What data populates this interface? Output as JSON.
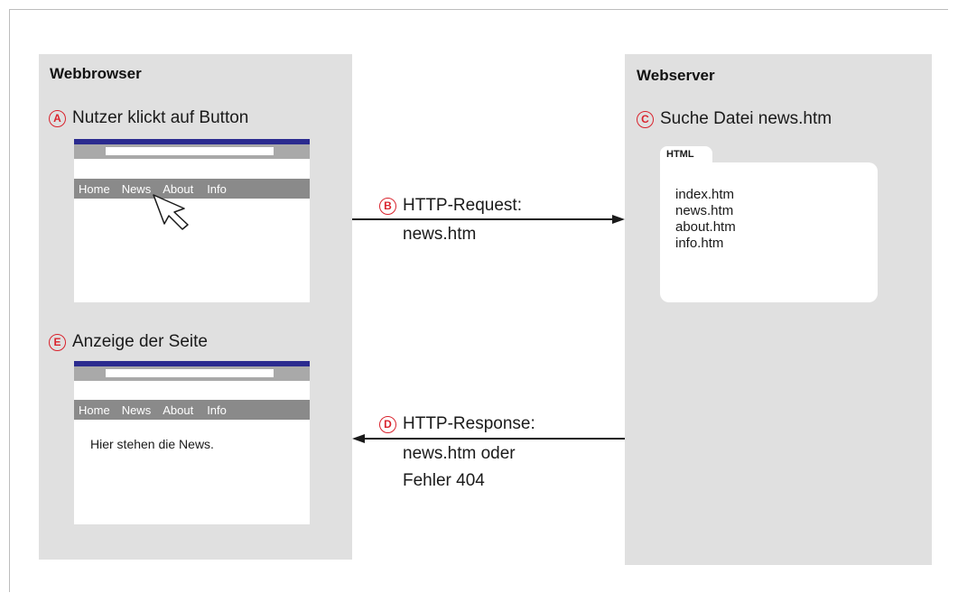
{
  "browser": {
    "title": "Webbrowser",
    "step_a": {
      "marker": "A",
      "label": "Nutzer klickt auf Button"
    },
    "step_e": {
      "marker": "E",
      "label": "Anzeige der Seite"
    },
    "nav_items": [
      "Home",
      "News",
      "About",
      "Info"
    ],
    "page_text": "Hier stehen die News."
  },
  "server": {
    "title": "Webserver",
    "step_c": {
      "marker": "C",
      "label": "Suche Datei news.htm"
    },
    "folder_label": "HTML",
    "files": [
      "index.htm",
      "news.htm",
      "about.htm",
      "info.htm"
    ]
  },
  "request": {
    "marker": "B",
    "line1": "HTTP-Request:",
    "line2": "news.htm"
  },
  "response": {
    "marker": "D",
    "line1": "HTTP-Response:",
    "line2": "news.htm oder",
    "line3": "Fehler 404"
  },
  "colors": {
    "marker_red": "#d9232d",
    "title_bar_blue": "#2b2b8f",
    "panel_gray": "#e0e0e0"
  }
}
